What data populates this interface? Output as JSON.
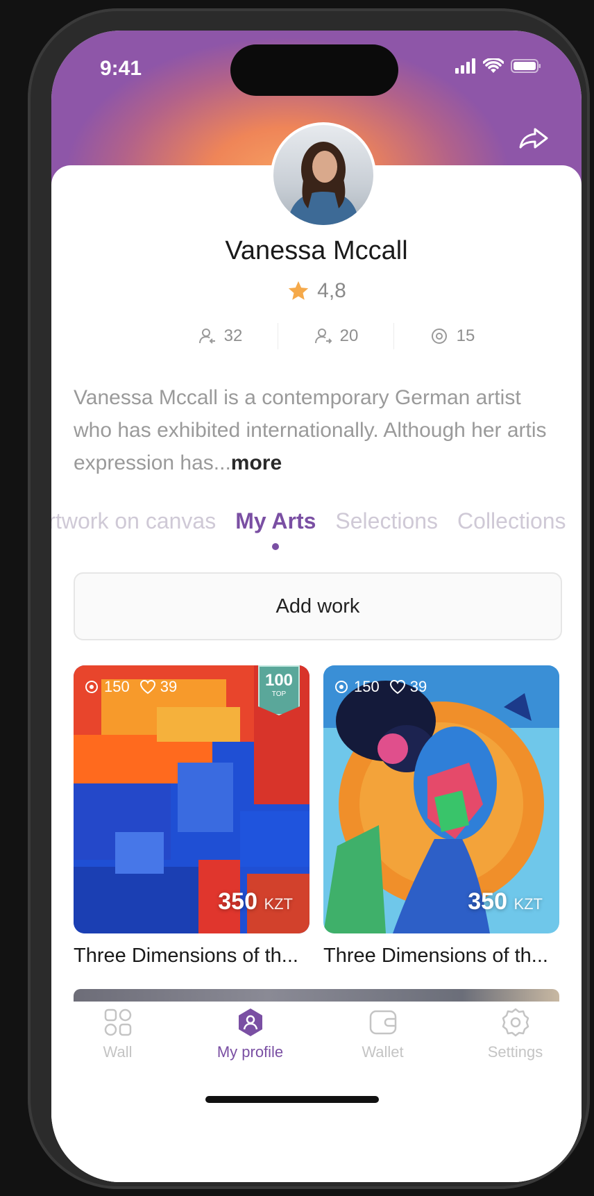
{
  "status_bar": {
    "time": "9:41"
  },
  "profile": {
    "name": "Vanessa Mccall",
    "rating": "4,8",
    "followers": "32",
    "following": "20",
    "views": "15",
    "bio": "Vanessa Mccall is a contemporary German artist who has exhibited internationally. Although her artis expression has...",
    "bio_more": "more"
  },
  "tabs": [
    {
      "label": "Artwork on canvas",
      "active": false
    },
    {
      "label": "My Arts",
      "active": true
    },
    {
      "label": "Selections",
      "active": false
    },
    {
      "label": "Collections",
      "active": false
    }
  ],
  "add_work_label": "Add work",
  "artworks": [
    {
      "views": "150",
      "likes": "39",
      "badge_number": "100",
      "badge_label": "TOP",
      "price": "350",
      "currency": "KZT",
      "title": "Three Dimensions of th..."
    },
    {
      "views": "150",
      "likes": "39",
      "price": "350",
      "currency": "KZT",
      "title": "Three Dimensions of th..."
    }
  ],
  "tabbar": [
    {
      "label": "Wall",
      "icon": "grid-icon",
      "active": false
    },
    {
      "label": "My profile",
      "icon": "profile-icon",
      "active": true
    },
    {
      "label": "Wallet",
      "icon": "wallet-icon",
      "active": false
    },
    {
      "label": "Settings",
      "icon": "gear-icon",
      "active": false
    }
  ],
  "colors": {
    "accent": "#7a4fa3",
    "star": "#f5a94a",
    "badge": "#5aa79a"
  }
}
